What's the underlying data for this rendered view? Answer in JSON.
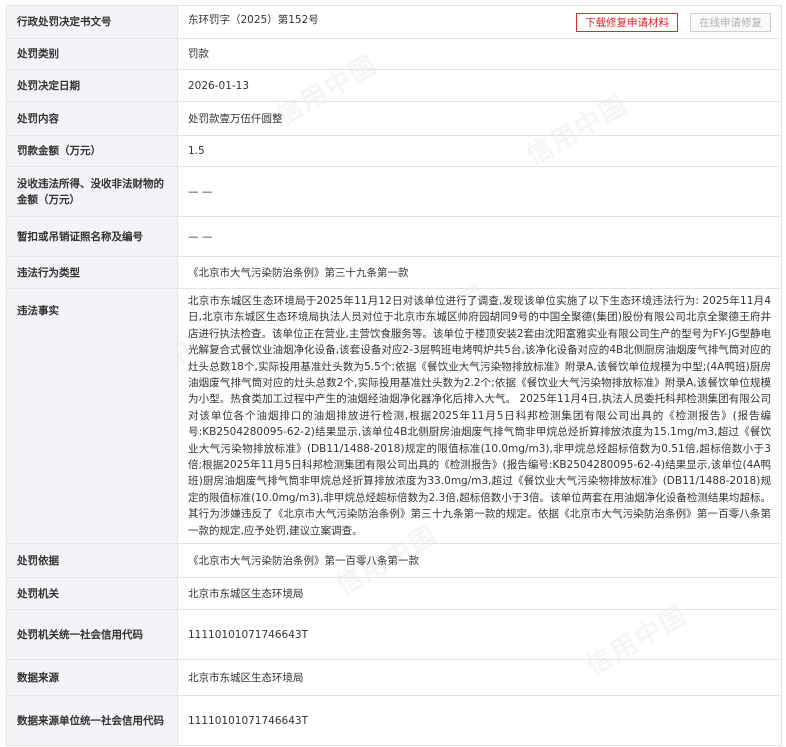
{
  "watermark": "信用中国",
  "colors": {
    "accent_red": "#e1252a",
    "label_bg": "#f3f4f7",
    "border": "#e4e4e4"
  },
  "rows": {
    "doc_no": {
      "label": "行政处罚决定书文号",
      "value": "东环罚字（2025）第152号"
    },
    "category": {
      "label": "处罚类别",
      "value": "罚款"
    },
    "decision_date": {
      "label": "处罚决定日期",
      "value": "2026-01-13"
    },
    "content": {
      "label": "处罚内容",
      "value": "处罚款壹万伍仟圆整"
    },
    "amount": {
      "label": "罚款金额（万元）",
      "value": "1.5"
    },
    "confiscation": {
      "label": "没收违法所得、没收非法财物的金额（万元）",
      "value": "— —"
    },
    "license": {
      "label": "暂扣或吊销证照名称及编号",
      "value": "— —"
    },
    "violation_type": {
      "label": "违法行为类型",
      "value": "《北京市大气污染防治条例》第三十九条第一款"
    },
    "facts": {
      "label": "违法事实",
      "value": "北京市东城区生态环境局于2025年11月12日对该单位进行了调查,发现该单位实施了以下生态环境违法行为: 2025年11月4日,北京市东城区生态环境局执法人员对位于北京市东城区帅府园胡同9号的中国全聚德(集团)股份有限公司北京全聚德王府井店进行执法检查。该单位正在营业,主营饮食服务等。该单位于楼顶安装2套由沈阳富雅实业有限公司生产的型号为FY-JG型静电光解复合式餐饮业油烟净化设备,该套设备对应2-3层鸭班电烤鸭炉共5台,该净化设备对应的4B北侧厨房油烟废气排气筒对应的灶头总数18个,实际投用基准灶头数为5.5个;依据《餐饮业大气污染物排放标准》附录A,该餐饮单位规模为中型;(4A鸭班)厨房油烟废气排气筒对应的灶头总数2个,实际投用基准灶头数为2.2个;依据《餐饮业大气污染物排放标准》附录A,该餐饮单位规模为小型。热食类加工过程中产生的油烟经油烟净化器净化后排入大气。 2025年11月4日,执法人员委托科邦检测集团有限公司对该单位各个油烟排口的油烟排放进行检测,根据2025年11月5日科邦检测集团有限公司出具的《检测报告》(报告编号:KB2504280095-62-2)结果显示,该单位4B北侧厨房油烟废气排气筒非甲烷总烃折算排放浓度为15.1mg/m3,超过《餐饮业大气污染物排放标准》(DB11/1488-2018)规定的限值标准(10.0mg/m3),非甲烷总烃超标倍数为0.51倍,超标倍数小于3倍;根据2025年11月5日科邦检测集团有限公司出具的《检测报告》(报告编号:KB2504280095-62-4)结果显示,该单位(4A鸭班)厨房油烟废气排气筒非甲烷总烃折算排放浓度为33.0mg/m3,超过《餐饮业大气污染物排放标准》(DB11/1488-2018)规定的限值标准(10.0mg/m3),非甲烷总烃超标倍数为2.3倍,超标倍数小于3倍。该单位两套在用油烟净化设备检测结果均超标。 其行为涉嫌违反了《北京市大气污染防治条例》第三十九条第一款的规定。依据《北京市大气污染防治条例》第一百零八条第一款的规定,应予处罚,建议立案调查。"
    },
    "basis": {
      "label": "处罚依据",
      "value": "《北京市大气污染防治条例》第一百零八条第一款"
    },
    "authority": {
      "label": "处罚机关",
      "value": "北京市东城区生态环境局"
    },
    "authority_code": {
      "label": "处罚机关统一社会信用代码",
      "value": "11110101071746643T"
    },
    "source": {
      "label": "数据来源",
      "value": "北京市东城区生态环境局"
    },
    "source_code": {
      "label": "数据来源单位统一社会信用代码",
      "value": "11110101071746643T"
    }
  },
  "buttons": {
    "download": "下载修复申请材料",
    "online": "在线申请修复"
  }
}
